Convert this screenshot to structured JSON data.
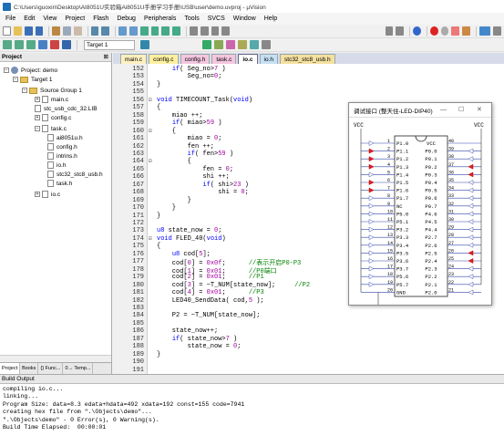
{
  "window": {
    "title": "C:\\Users\\guoxin\\Desktop\\AI8051U实验箱Ai8051U手册学习手册\\USB\\user\\demo.uvproj - µVision"
  },
  "menu": [
    "File",
    "Edit",
    "View",
    "Project",
    "Flash",
    "Debug",
    "Peripherals",
    "Tools",
    "SVCS",
    "Window",
    "Help"
  ],
  "toolbar": {
    "target": "Target 1"
  },
  "project_panel": {
    "title": "Project",
    "items": [
      {
        "label": "Project: demo",
        "kind": "root"
      },
      {
        "label": "Target 1",
        "kind": "target"
      },
      {
        "label": "Source Group 1",
        "kind": "folder"
      },
      {
        "label": "main.c",
        "kind": "file"
      },
      {
        "label": "stc_usb_cdc_32.LIB",
        "kind": "file"
      },
      {
        "label": "config.c",
        "kind": "file"
      },
      {
        "label": "task.c",
        "kind": "file"
      },
      {
        "label": "ai8051u.h",
        "kind": "file"
      },
      {
        "label": "config.h",
        "kind": "file"
      },
      {
        "label": "intrins.h",
        "kind": "file"
      },
      {
        "label": "io.h",
        "kind": "file"
      },
      {
        "label": "stc32_stc8_usb.h",
        "kind": "file"
      },
      {
        "label": "task.h",
        "kind": "file"
      },
      {
        "label": "io.c",
        "kind": "file"
      }
    ],
    "tabs": [
      "Project",
      "Books",
      "{} Func...",
      "0→ Temp..."
    ]
  },
  "editor_tabs": [
    {
      "label": "main.c",
      "color": "#fff0c0"
    },
    {
      "label": "config.c",
      "color": "#fff0a0"
    },
    {
      "label": "config.h",
      "color": "#f4c6e0"
    },
    {
      "label": "task.c",
      "color": "#f4c6e0"
    },
    {
      "label": "io.c",
      "color": "#ffffff",
      "active": true
    },
    {
      "label": "io.h",
      "color": "#c6e0f4"
    },
    {
      "label": "stc32_stc8_usb.h",
      "color": "#f4e0a0"
    }
  ],
  "code_lines": [
    {
      "n": 152,
      "t": "    if( Seg_no>7 )"
    },
    {
      "n": 153,
      "t": "        Seg_no=0;"
    },
    {
      "n": 154,
      "t": "}"
    },
    {
      "n": 155,
      "t": ""
    },
    {
      "n": 156,
      "t": "void TIMECOUNT_Task(void)"
    },
    {
      "n": 157,
      "t": "{"
    },
    {
      "n": 158,
      "t": "    miao ++;"
    },
    {
      "n": 159,
      "t": "    if( miao>59 )"
    },
    {
      "n": 160,
      "t": "    {"
    },
    {
      "n": 161,
      "t": "        miao = 0;"
    },
    {
      "n": 162,
      "t": "        fen ++;"
    },
    {
      "n": 163,
      "t": "        if( fen>59 )"
    },
    {
      "n": 164,
      "t": "        {"
    },
    {
      "n": 165,
      "t": "            fen = 0;"
    },
    {
      "n": 166,
      "t": "            shi ++;"
    },
    {
      "n": 167,
      "t": "            if( shi>23 )"
    },
    {
      "n": 168,
      "t": "                shi = 0;"
    },
    {
      "n": 169,
      "t": "        }"
    },
    {
      "n": 170,
      "t": "    }"
    },
    {
      "n": 171,
      "t": "}"
    },
    {
      "n": 172,
      "t": ""
    },
    {
      "n": 173,
      "t": "u8 state_now = 0;"
    },
    {
      "n": 174,
      "t": "void FLED_40(void)"
    },
    {
      "n": 175,
      "t": "{"
    },
    {
      "n": 176,
      "t": "    u8 cod[5];"
    },
    {
      "n": 177,
      "t": "    cod[0] = 0x0f;      //表示开启P0-P3"
    },
    {
      "n": 178,
      "t": "    cod[1] = 0x01;      //P0端口"
    },
    {
      "n": 179,
      "t": "    cod[2] = 0x01;      //P1"
    },
    {
      "n": 180,
      "t": "    cod[3] = ~T_NUM[state_now];     //P2"
    },
    {
      "n": 181,
      "t": "    cod[4] = 0x01;      //P3"
    },
    {
      "n": 182,
      "t": "    LED40_SendData( cod,5 );"
    },
    {
      "n": 183,
      "t": ""
    },
    {
      "n": 184,
      "t": "    P2 = ~T_NUM[state_now];"
    },
    {
      "n": 185,
      "t": ""
    },
    {
      "n": 186,
      "t": "    state_now++;"
    },
    {
      "n": 187,
      "t": "    if( state_now>7 )"
    },
    {
      "n": 188,
      "t": "        state_now = 0;"
    },
    {
      "n": 189,
      "t": "}"
    },
    {
      "n": 190,
      "t": ""
    },
    {
      "n": 191,
      "t": ""
    }
  ],
  "popup": {
    "title": "调试接口 (整天住-LED-DIP40)",
    "vcc": "VCC",
    "gnd": "GND",
    "chip": {
      "left_pins": [
        {
          "n": "1",
          "label": "P1.0"
        },
        {
          "n": "2",
          "label": "P1.1"
        },
        {
          "n": "3",
          "label": "P1.2"
        },
        {
          "n": "4",
          "label": "P1.3"
        },
        {
          "n": "5",
          "label": "P1.4"
        },
        {
          "n": "6",
          "label": "P1.5"
        },
        {
          "n": "7",
          "label": "P1.6"
        },
        {
          "n": "8",
          "label": "P1.7"
        },
        {
          "n": "9",
          "label": "NC"
        },
        {
          "n": "10",
          "label": "P5.0"
        },
        {
          "n": "11",
          "label": "P5.1"
        },
        {
          "n": "12",
          "label": "P3.2"
        },
        {
          "n": "13",
          "label": "P3.3"
        },
        {
          "n": "14",
          "label": "P3.4"
        },
        {
          "n": "15",
          "label": "P3.5"
        },
        {
          "n": "16",
          "label": "P3.6"
        },
        {
          "n": "17",
          "label": "P3.7"
        },
        {
          "n": "18",
          "label": "P5.6"
        },
        {
          "n": "19",
          "label": "P5.7"
        },
        {
          "n": "20",
          "label": "GND"
        }
      ],
      "right_pins": [
        {
          "n": "40",
          "label": "VCC"
        },
        {
          "n": "39",
          "label": "P0.0"
        },
        {
          "n": "38",
          "label": "P0.1"
        },
        {
          "n": "37",
          "label": "P0.2"
        },
        {
          "n": "36",
          "label": "P0.3"
        },
        {
          "n": "35",
          "label": "P0.4"
        },
        {
          "n": "34",
          "label": "P0.5"
        },
        {
          "n": "33",
          "label": "P0.6"
        },
        {
          "n": "32",
          "label": "P0.7"
        },
        {
          "n": "31",
          "label": "P4.6"
        },
        {
          "n": "30",
          "label": "P4.5"
        },
        {
          "n": "29",
          "label": "P4.4"
        },
        {
          "n": "28",
          "label": "P2.7"
        },
        {
          "n": "27",
          "label": "P2.6"
        },
        {
          "n": "26",
          "label": "P2.5"
        },
        {
          "n": "25",
          "label": "P2.4"
        },
        {
          "n": "24",
          "label": "P2.3"
        },
        {
          "n": "23",
          "label": "P2.2"
        },
        {
          "n": "22",
          "label": "P2.1"
        },
        {
          "n": "21",
          "label": "P2.0"
        }
      ],
      "left_led_on": [
        false,
        true,
        true,
        true,
        false,
        true,
        true,
        false,
        false,
        false,
        false,
        false,
        false,
        false,
        false,
        false,
        false,
        false,
        false
      ],
      "right_led_on": [
        false,
        false,
        true,
        true,
        false,
        false,
        false,
        false,
        false,
        false,
        false,
        false,
        false,
        true,
        true,
        false,
        false,
        false,
        false
      ]
    }
  },
  "build": {
    "title": "Build Output",
    "lines": [
      "compiling io.c...",
      "linking...",
      "Program Size: data=8.3 edata+hdata=492 xdata=192 const=155 code=7941",
      "creating hex file from \".\\Objects\\demo\"...",
      "\".\\Objects\\demo\" - 0 Error(s), 0 Warning(s).",
      "Build Time Elapsed:  00:00:01"
    ]
  }
}
